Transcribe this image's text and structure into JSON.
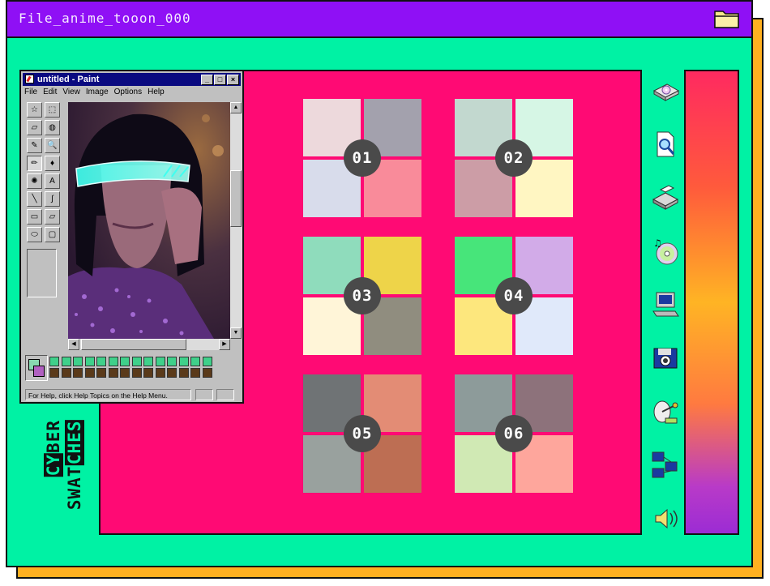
{
  "window": {
    "title": "File_anime_tooon_000",
    "folder_icon": "folder-icon",
    "background": "#00f2a4",
    "titlebar_color": "#8f10f5",
    "shadow_color": "#ffb020"
  },
  "canvas": {
    "color": "#ff0a74"
  },
  "swatches": [
    {
      "label": "01",
      "colors": [
        "#edd9dc",
        "#a3a1ad",
        "#d8dceb",
        "#f98b9a"
      ]
    },
    {
      "label": "02",
      "colors": [
        "#c2d8cf",
        "#d6f6e5",
        "#cc9da6",
        "#fff6c2"
      ]
    },
    {
      "label": "03",
      "colors": [
        "#8fdcbc",
        "#eed449",
        "#fff5d8",
        "#908d7f"
      ]
    },
    {
      "label": "04",
      "colors": [
        "#47e57a",
        "#d2abe8",
        "#fde77d",
        "#e0e9fa"
      ]
    },
    {
      "label": "05",
      "colors": [
        "#6f7375",
        "#e38c75",
        "#99a19e",
        "#bd6e53"
      ]
    },
    {
      "label": "06",
      "colors": [
        "#8d9b9a",
        "#8d727b",
        "#d0e9b4",
        "#fea69c"
      ]
    }
  ],
  "paint": {
    "title": "untitled - Paint",
    "window_buttons": [
      "_",
      "□",
      "×"
    ],
    "menus": [
      "File",
      "Edit",
      "View",
      "Image",
      "Options",
      "Help"
    ],
    "status": "For Help, click Help Topics on the Help Menu.",
    "tools": [
      "free-select-icon",
      "rect-select-icon",
      "eraser-icon",
      "fill-icon",
      "color-picker-icon",
      "magnifier-icon",
      "pencil-icon",
      "brush-icon",
      "airbrush-icon",
      "text-icon",
      "line-icon",
      "curve-icon",
      "rectangle-icon",
      "polygon-icon",
      "ellipse-icon",
      "rounded-rect-icon"
    ],
    "tool_glyphs": [
      "☆",
      "⬚",
      "▱",
      "◍",
      "✎",
      "🔍",
      "✏",
      "♦",
      "✺",
      "A",
      "╲",
      "∫",
      "▭",
      "▱",
      "⬭",
      "▢"
    ],
    "palette_top": [
      "#3fd08a",
      "#3fd08a",
      "#3fd08a",
      "#3fd08a",
      "#3fd08a",
      "#3fd08a",
      "#3fd08a",
      "#3fd08a",
      "#3fd08a",
      "#3fd08a",
      "#3fd08a",
      "#3fd08a",
      "#3fd08a",
      "#3fd08a"
    ],
    "palette_bottom": [
      "#5a3a1a",
      "#5a3a1a",
      "#5a3a1a",
      "#5a3a1a",
      "#5a3a1a",
      "#5a3a1a",
      "#5a3a1a",
      "#5a3a1a",
      "#5a3a1a",
      "#5a3a1a",
      "#5a3a1a",
      "#5a3a1a",
      "#5a3a1a",
      "#5a3a1a"
    ]
  },
  "side_label": {
    "line1_highlight": "CY",
    "line1_rest": "BER",
    "line2_rest": "SWAT",
    "line2_highlight": "CHES"
  },
  "desktop_icons": [
    "disk-drive-icon",
    "file-search-icon",
    "printer-icon",
    "music-cd-icon",
    "computer-icon",
    "camera-disk-icon",
    "satellite-icon",
    "network-icon",
    "speaker-icon"
  ],
  "gradient": {
    "top": "#ff2a60",
    "middle": "#ffb424",
    "bottom": "#9c2cd4"
  }
}
